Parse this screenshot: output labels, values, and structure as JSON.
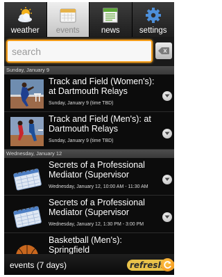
{
  "tabs": [
    {
      "label": "weather",
      "icon": "weather-icon",
      "active": false
    },
    {
      "label": "events",
      "icon": "calendar-icon",
      "active": true
    },
    {
      "label": "news",
      "icon": "news-icon",
      "active": false
    },
    {
      "label": "settings",
      "icon": "gear-icon",
      "active": false
    }
  ],
  "search": {
    "placeholder": "search"
  },
  "sections": [
    {
      "date": "Sunday, January 9",
      "items": [
        {
          "title": "Track and Field (Women's): at Dartmouth Relays",
          "subtitle": "Sunday, January 9 (time TBD)",
          "thumbnail": "track-photo"
        },
        {
          "title": "Track and Field (Men's): at Dartmouth Relays",
          "subtitle": "Sunday, January 9 (time TBD)",
          "thumbnail": "track-photo"
        }
      ]
    },
    {
      "date": "Wednesday, January 12",
      "items": [
        {
          "title": "Secrets of a Professional Mediator (Supervisor",
          "subtitle": "Wednesday, January 12, 10:00 AM - 11:30 AM",
          "thumbnail": "calendar-book-icon"
        },
        {
          "title": "Secrets of a Professional Mediator (Supervisor",
          "subtitle": "Wednesday, January 12, 1:30 PM - 3:00 PM",
          "thumbnail": "calendar-book-icon"
        },
        {
          "title": "Basketball (Men's): Springfield",
          "subtitle": "",
          "thumbnail": "basketball-icon"
        }
      ]
    }
  ],
  "footer": {
    "status": "events (7 days)",
    "refresh_label": "refresh"
  },
  "colors": {
    "accent": "#f59d18",
    "background": "#0c0c0c",
    "refresh": "#e9c24a"
  }
}
